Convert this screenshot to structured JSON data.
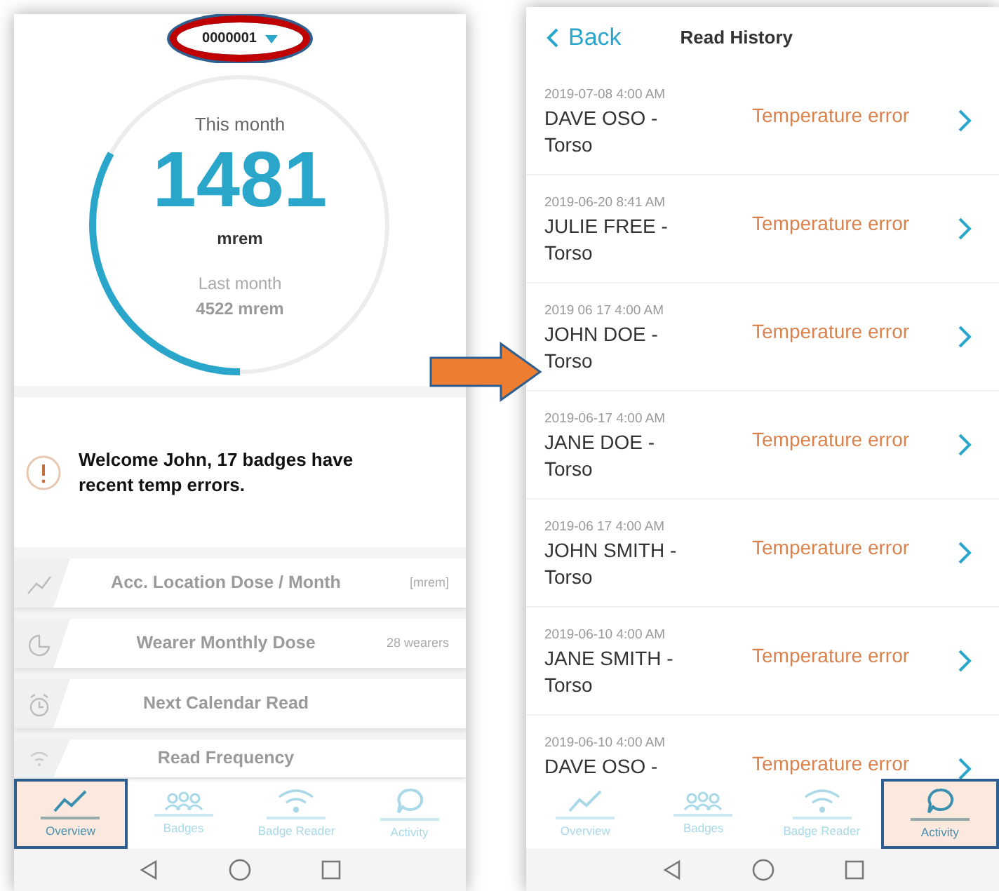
{
  "overview_screen": {
    "badge_selector": {
      "value": "0000001",
      "circled": true
    },
    "dose_gauge": {
      "label": "This month",
      "value": "1481",
      "unit": "mrem",
      "level": 0.33,
      "previous_label": "Last month",
      "previous_value": "4522 mrem"
    },
    "alert": {
      "message": "Welcome John, 17 badges have recent temp errors."
    },
    "cards": [
      {
        "title": "Acc. Location Dose / Month",
        "detail": "[mrem]"
      },
      {
        "title": "Wearer Monthly Dose",
        "detail": "28 wearers"
      },
      {
        "title": "Next Calendar Read"
      },
      {
        "title": "Read Frequency"
      }
    ],
    "tab_bar": [
      {
        "label": "Overview",
        "selected": true
      },
      {
        "label": "Badges",
        "selected": false
      },
      {
        "label": "Badge Reader",
        "selected": false
      },
      {
        "label": "Activity",
        "selected": false
      }
    ]
  },
  "read_history_screen": {
    "back": "Back",
    "title": "Read History",
    "reads": [
      {
        "timestamp": "2019-07-08 4:00 AM",
        "wearer": "DAVE OSO -",
        "location": "Torso",
        "status": "Temperature error"
      },
      {
        "timestamp": "2019-06-20 8:41 AM",
        "wearer": "JULIE FREE -",
        "location": "Torso",
        "status": "Temperature error"
      },
      {
        "timestamp": "2019 06 17 4:00 AM",
        "wearer": "JOHN DOE -",
        "location": "Torso",
        "status": "Temperature error"
      },
      {
        "timestamp": "2019-06-17 4:00 AM",
        "wearer": "JANE DOE -",
        "location": "Torso",
        "status": "Temperature error"
      },
      {
        "timestamp": "2019-06 17 4:00 AM",
        "wearer": "JOHN SMITH -",
        "location": "Torso",
        "status": "Temperature error"
      },
      {
        "timestamp": "2019-06-10 4:00 AM",
        "wearer": "JANE SMITH -",
        "location": "Torso",
        "status": "Temperature error"
      },
      {
        "timestamp": "2019-06-10 4:00 AM",
        "wearer": "DAVE OSO -",
        "status": "Temperature error"
      }
    ],
    "tab_bar": [
      {
        "label": "Overview",
        "selected": false
      },
      {
        "label": "Badges",
        "selected": false
      },
      {
        "label": "Badge Reader",
        "selected": false
      },
      {
        "label": "Activity",
        "selected": true
      }
    ]
  }
}
